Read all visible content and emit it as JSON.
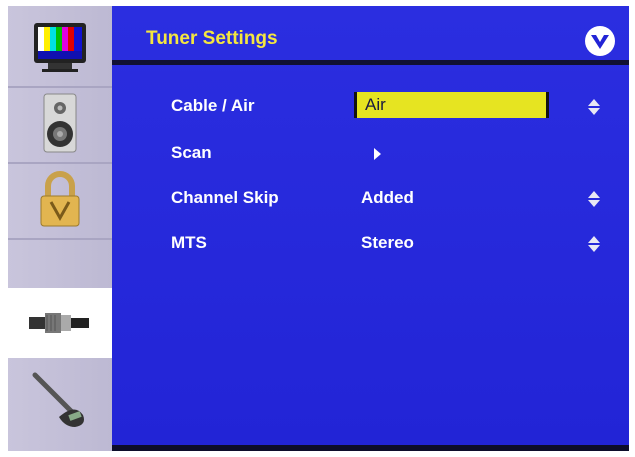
{
  "menu": {
    "title": "Tuner Settings",
    "logo_icon": "vizio-v-logo-icon",
    "colors": {
      "background": "#2224d6",
      "title": "#f4e640",
      "highlight": "#e6e421",
      "sidebar": "#c9c5dc"
    }
  },
  "sidebar": {
    "items": [
      {
        "name": "picture",
        "icon": "tv-color-bars-icon",
        "active": false
      },
      {
        "name": "audio",
        "icon": "speaker-icon",
        "active": false
      },
      {
        "name": "parental",
        "icon": "padlock-icon",
        "active": false
      },
      {
        "name": "tuner",
        "icon": "coax-cable-icon",
        "active": true
      },
      {
        "name": "setup",
        "icon": "wrench-icon",
        "active": false
      }
    ]
  },
  "settings": [
    {
      "label": "Cable / Air",
      "value": "Air",
      "control": "up-down-arrows-icon",
      "selected": true
    },
    {
      "label": "Scan",
      "value": "",
      "control": "play-arrow-icon",
      "selected": false
    },
    {
      "label": "Channel Skip",
      "value": "Added",
      "control": "up-down-arrows-icon",
      "selected": false
    },
    {
      "label": "MTS",
      "value": "Stereo",
      "control": "up-down-arrows-icon",
      "selected": false
    }
  ]
}
